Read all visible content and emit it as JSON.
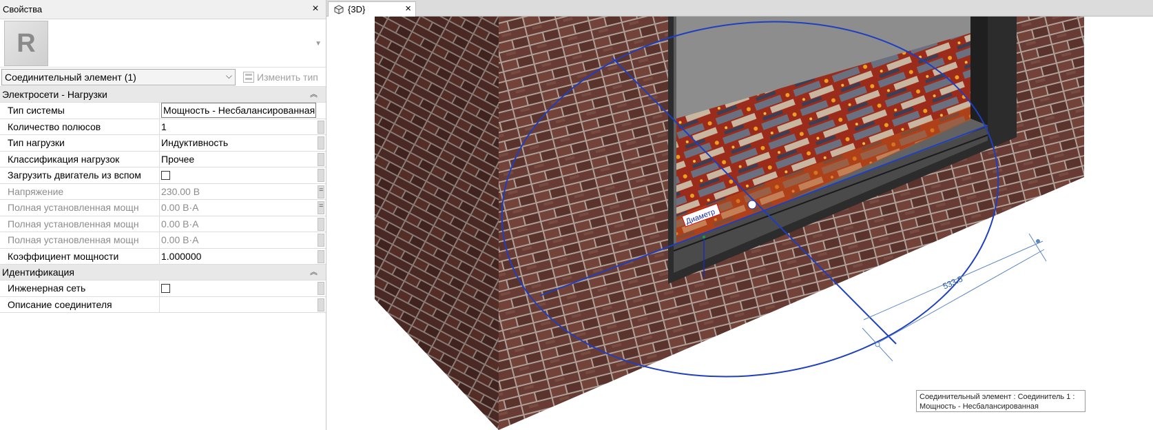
{
  "panel": {
    "title": "Свойства",
    "close": "×",
    "type_selector": "Соединительный элемент (1)",
    "edit_type_label": "Изменить тип"
  },
  "groups": [
    {
      "title": "Электросети - Нагрузки",
      "rows": [
        {
          "name": "Тип системы",
          "value": "Мощность - Несбалансированная",
          "state": "editing"
        },
        {
          "name": "Количество полюсов",
          "value": "1"
        },
        {
          "name": "Тип нагрузки",
          "value": "Индуктивность"
        },
        {
          "name": "Классификация нагрузок",
          "value": "Прочее"
        },
        {
          "name": "Загрузить двигатель из вспом",
          "value": "",
          "checkbox": false
        },
        {
          "name": "Напряжение",
          "value": "230.00 В",
          "disabled": true
        },
        {
          "name": "Полная установленная мощн",
          "value": "0.00 В·А",
          "disabled": true
        },
        {
          "name": "Полная установленная мощн",
          "value": "0.00 В·А",
          "disabled": true
        },
        {
          "name": "Полная установленная мощн",
          "value": "0.00 В·А",
          "disabled": true
        },
        {
          "name": "Коэффициент мощности",
          "value": "1.000000"
        }
      ]
    },
    {
      "title": "Идентификация",
      "rows": [
        {
          "name": "Инженерная сеть",
          "value": "",
          "checkbox": false
        },
        {
          "name": "Описание соединителя",
          "value": ""
        }
      ]
    }
  ],
  "view": {
    "tab_label": "{3D}",
    "tab_close": "×",
    "dimension_value": "533.5",
    "diameter_label": "Диаметр",
    "tooltip_line1": "Соединительный элемент : Соединитель 1 :",
    "tooltip_line2": "Мощность - Несбалансированная"
  },
  "colors": {
    "brick": "#6e4038",
    "mortar": "#b9aca5",
    "selection": "#1f3fbf",
    "dimension": "#5b86c0"
  }
}
